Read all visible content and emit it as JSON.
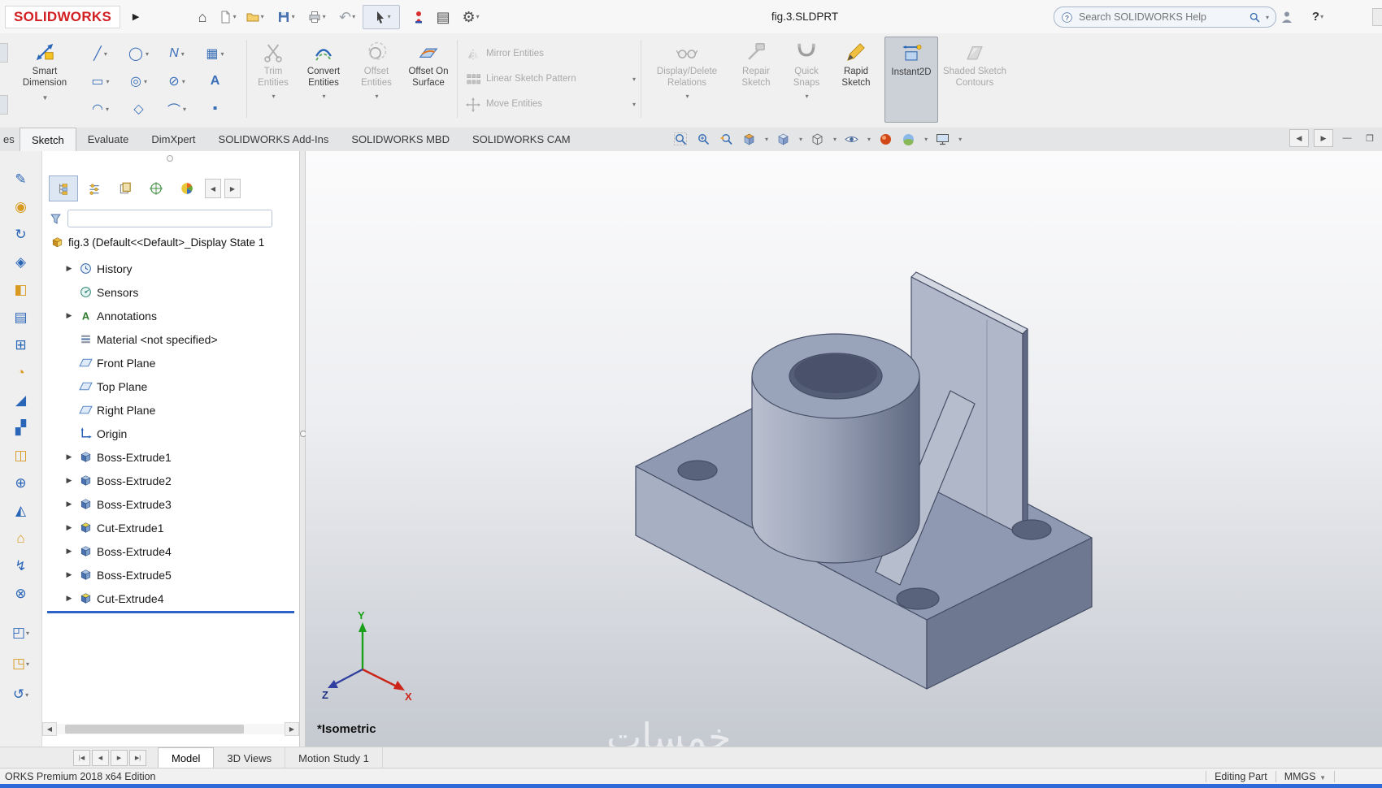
{
  "titlebar": {
    "logo": "SOLIDWORKS",
    "document_title": "fig.3.SLDPRT",
    "search_placeholder": "Search SOLIDWORKS Help",
    "help": "?"
  },
  "ribbon": {
    "smart_dimension": {
      "label": "Smart Dimension"
    },
    "palette": [
      {
        "glyph": "╱"
      },
      {
        "glyph": "◯"
      },
      {
        "glyph": "N"
      },
      {
        "glyph": "▦"
      },
      {
        "glyph": "▭"
      },
      {
        "glyph": "◎"
      },
      {
        "glyph": "⊘"
      },
      {
        "glyph": "A"
      },
      {
        "glyph": "◠"
      },
      {
        "glyph": "◇"
      },
      {
        "glyph": "⌒"
      },
      {
        "glyph": "▪"
      }
    ],
    "buttons": [
      {
        "label": "Trim Entities",
        "enabled": false
      },
      {
        "label": "Convert Entities",
        "enabled": true
      },
      {
        "label": "Offset Entities",
        "enabled": false
      },
      {
        "label": "Offset On Surface",
        "enabled": true
      },
      {
        "label": "Mirror Entities",
        "enabled": false
      },
      {
        "label": "Linear Sketch Pattern",
        "enabled": false
      },
      {
        "label": "Move Entities",
        "enabled": false
      },
      {
        "label": "Display/Delete Relations",
        "enabled": false
      },
      {
        "label": "Repair Sketch",
        "enabled": false
      },
      {
        "label": "Quick Snaps",
        "enabled": false
      },
      {
        "label": "Rapid Sketch",
        "enabled": true
      },
      {
        "label": "Instant2D",
        "enabled": true,
        "active": true
      },
      {
        "label": "Shaded Sketch Contours",
        "enabled": false
      }
    ]
  },
  "command_tabs": {
    "items": [
      {
        "label": "es"
      },
      {
        "label": "Sketch",
        "active": true
      },
      {
        "label": "Evaluate"
      },
      {
        "label": "DimXpert"
      },
      {
        "label": "SOLIDWORKS Add-Ins"
      },
      {
        "label": "SOLIDWORKS MBD"
      },
      {
        "label": "SOLIDWORKS CAM"
      }
    ]
  },
  "feature_tree": {
    "root_label": "fig.3  (Default<<Default>_Display State 1",
    "items": [
      {
        "label": "History"
      },
      {
        "label": "Sensors"
      },
      {
        "label": "Annotations"
      },
      {
        "label": "Material <not specified>"
      },
      {
        "label": "Front Plane"
      },
      {
        "label": "Top Plane"
      },
      {
        "label": "Right Plane"
      },
      {
        "label": "Origin"
      },
      {
        "label": "Boss-Extrude1"
      },
      {
        "label": "Boss-Extrude2"
      },
      {
        "label": "Boss-Extrude3"
      },
      {
        "label": "Cut-Extrude1"
      },
      {
        "label": "Boss-Extrude4"
      },
      {
        "label": "Boss-Extrude5"
      },
      {
        "label": "Cut-Extrude4"
      }
    ]
  },
  "viewport": {
    "view_label": "*Isometric",
    "watermark": "خمسات",
    "axes": {
      "x": "X",
      "y": "Y",
      "z": "Z"
    }
  },
  "bottom_tabs": {
    "items": [
      {
        "label": "Model",
        "active": true
      },
      {
        "label": "3D Views"
      },
      {
        "label": "Motion Study 1"
      }
    ]
  },
  "statusbar": {
    "edition": "ORKS Premium 2018 x64 Edition",
    "mode": "Editing Part",
    "units": "MMGS"
  },
  "colors": {
    "accent_blue": "#2a66b8",
    "logo_red": "#d21f21",
    "model_gray": "#8f99b2",
    "rollback_blue": "#2a62c8"
  }
}
